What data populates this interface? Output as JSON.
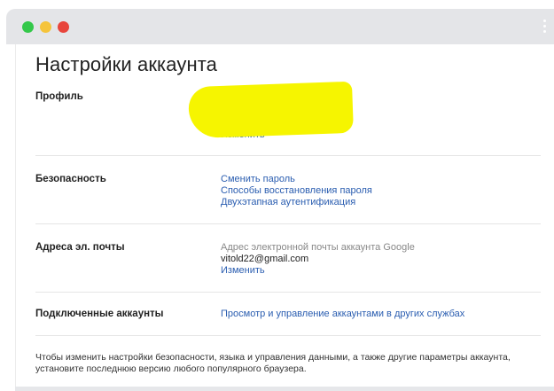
{
  "page": {
    "title": "Настройки аккаунта"
  },
  "profile": {
    "label": "Профиль",
    "change_link": "Изменить"
  },
  "security": {
    "label": "Безопасность",
    "links": [
      "Сменить пароль",
      "Способы восстановления пароля",
      "Двухэтапная аутентификация"
    ]
  },
  "email": {
    "label": "Адреса эл. почты",
    "caption": "Адрес электронной почты аккаунта Google",
    "address": "vitold22@gmail.com",
    "change_link": "Изменить"
  },
  "connected": {
    "label": "Подключенные аккаунты",
    "link": "Просмотр и управление аккаунтами в других службах"
  },
  "footer": {
    "note": "Чтобы изменить настройки безопасности, языка и управления данными, а также другие параметры аккаунта, установите последнюю версию любого популярного браузера."
  },
  "colors": {
    "link": "#2a5db0",
    "redaction": "#f6f500",
    "dot_green": "#34c84a",
    "dot_yellow": "#f5c43b",
    "dot_red": "#e8453c"
  }
}
